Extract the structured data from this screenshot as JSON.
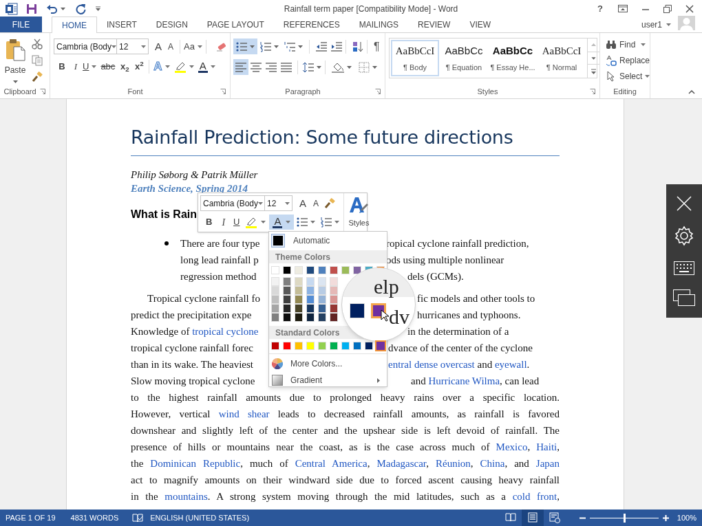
{
  "title_bar": {
    "title": "Rainfall term paper [Compatibility Mode] - Word",
    "help": "?"
  },
  "tabs": [
    {
      "label": "FILE",
      "kind": "file",
      "selected": false
    },
    {
      "label": "HOME",
      "kind": "tab",
      "selected": true
    },
    {
      "label": "INSERT",
      "kind": "tab",
      "selected": false
    },
    {
      "label": "DESIGN",
      "kind": "tab",
      "selected": false
    },
    {
      "label": "PAGE LAYOUT",
      "kind": "tab",
      "selected": false
    },
    {
      "label": "REFERENCES",
      "kind": "tab",
      "selected": false
    },
    {
      "label": "MAILINGS",
      "kind": "tab",
      "selected": false
    },
    {
      "label": "REVIEW",
      "kind": "tab",
      "selected": false
    },
    {
      "label": "VIEW",
      "kind": "tab",
      "selected": false
    }
  ],
  "account": {
    "user": "user1"
  },
  "ribbon": {
    "clipboard": {
      "paste": "Paste",
      "label": "Clipboard"
    },
    "font": {
      "name": "Cambria (Body",
      "size": "12",
      "grow": "A",
      "shrink": "A",
      "change_case": "Aa",
      "bold": "B",
      "italic": "I",
      "underline": "U",
      "strikethrough": "abc",
      "subscript": "x$_{2}$",
      "superscript": "x$^{2}$",
      "text_effects": "A",
      "font_color": "A",
      "label": "Font"
    },
    "paragraph": {
      "list_buttons": [
        {
          "kind": "bullets",
          "selected": true
        },
        {
          "kind": "numbering",
          "selected": false
        },
        {
          "kind": "multilevel",
          "selected": false
        }
      ],
      "show_marks": "¶",
      "align_buttons": [
        {
          "kind": "left",
          "selected": true
        },
        {
          "kind": "center",
          "selected": false
        },
        {
          "kind": "right",
          "selected": false
        },
        {
          "kind": "justify",
          "selected": false
        }
      ],
      "label": "Paragraph"
    },
    "styles": {
      "items": [
        {
          "preview": "AaBbCcI",
          "name": "¶ Body",
          "kind": "serif",
          "selected": true
        },
        {
          "preview": "AaBbCc",
          "name": "¶ Equation",
          "kind": "sans",
          "selected": false
        },
        {
          "preview": "AaBbCc",
          "name": "¶ Essay He...",
          "kind": "bold",
          "selected": false
        },
        {
          "preview": "AaBbCcI",
          "name": "¶ Normal",
          "kind": "serif",
          "selected": false
        }
      ],
      "label": "Styles"
    },
    "editing": {
      "find": "Find",
      "replace": "Replace",
      "select": "Select",
      "label": "Editing"
    }
  },
  "document": {
    "title": "Rainfall Prediction: Some future directions",
    "authors": "Philip Søborg & Patrik Müller",
    "course": "Earth Science, Spring 2014",
    "heading": "What is Rain",
    "bullet_lines": [
      {
        "left": [
          {
            "text": "There are four type",
            "link": false
          }
        ],
        "right": [
          {
            "text": "ropical cyclone rainfall prediction,",
            "link": false
          }
        ]
      },
      {
        "left": [
          {
            "text": "long lead rainfall p",
            "link": false
          }
        ],
        "right": [
          {
            "text": "ods using multiple nonlinear",
            "link": false
          }
        ]
      },
      {
        "left": [
          {
            "text": "regression method",
            "link": false
          }
        ],
        "right": [
          {
            "text": "dels (GCMs).",
            "link": false
          }
        ]
      }
    ],
    "paragraph_lines": [
      {
        "kind": "split",
        "left": [
          {
            "text": "Tropical cyclone rainfall fo",
            "link": false
          }
        ],
        "right": [
          {
            "text": "fic models and other tools to",
            "link": false
          }
        ]
      },
      {
        "kind": "split",
        "left": [
          {
            "text": "predict the precipitation expe",
            "link": false
          }
        ],
        "right": [
          {
            "text": "hurricanes and typhoons.",
            "link": false
          }
        ]
      },
      {
        "kind": "split",
        "left": [
          {
            "text": "Knowledge of ",
            "link": false
          },
          {
            "text": "tropical cyclone",
            "link": true
          }
        ],
        "right": [
          {
            "text": "in the determination of a",
            "link": false
          }
        ]
      },
      {
        "kind": "split",
        "left": [
          {
            "text": "tropical cyclone rainfall forec",
            "link": false
          }
        ],
        "right": [
          {
            "text": "dvance of the center of the cyclone",
            "link": false
          }
        ]
      },
      {
        "kind": "split",
        "left": [
          {
            "text": "than in its wake. The heaviest",
            "link": false
          }
        ],
        "right": [
          {
            "text": "entral dense overcast",
            "link": true
          },
          {
            "text": " and ",
            "link": false
          },
          {
            "text": "eyewall",
            "link": true
          },
          {
            "text": ".",
            "link": false
          }
        ]
      },
      {
        "kind": "split",
        "left": [
          {
            "text": "Slow moving tropical cyclone",
            "link": false
          }
        ],
        "right": [
          {
            "text": "and ",
            "link": false
          },
          {
            "text": "Hurricane Wilma",
            "link": true
          },
          {
            "text": ", can lead",
            "link": false
          }
        ]
      },
      {
        "kind": "full",
        "segments": [
          {
            "text": "to the highest rainfall amounts due to prolonged heavy rains over a specific location.",
            "link": false
          }
        ]
      },
      {
        "kind": "full",
        "segments": [
          {
            "text": "However, vertical ",
            "link": false
          },
          {
            "text": "wind shear",
            "link": true
          },
          {
            "text": " leads to decreased rainfall amounts, as rainfall is favored",
            "link": false
          }
        ]
      },
      {
        "kind": "full",
        "segments": [
          {
            "text": "downshear and slightly left of the center and the upshear side is left devoid of rainfall. The",
            "link": false
          }
        ]
      },
      {
        "kind": "full",
        "segments": [
          {
            "text": "presence of hills or mountains near the coast, as is the case across much of ",
            "link": false
          },
          {
            "text": "Mexico",
            "link": true
          },
          {
            "text": ", ",
            "link": false
          },
          {
            "text": "Haiti",
            "link": true
          },
          {
            "text": ",",
            "link": false
          }
        ]
      },
      {
        "kind": "full",
        "segments": [
          {
            "text": "the ",
            "link": false
          },
          {
            "text": "Dominican Republic",
            "link": true
          },
          {
            "text": ", much of ",
            "link": false
          },
          {
            "text": "Central America",
            "link": true
          },
          {
            "text": ", ",
            "link": false
          },
          {
            "text": "Madagascar",
            "link": true
          },
          {
            "text": ", ",
            "link": false
          },
          {
            "text": "Réunion",
            "link": true
          },
          {
            "text": ", ",
            "link": false
          },
          {
            "text": "China",
            "link": true
          },
          {
            "text": ", and ",
            "link": false
          },
          {
            "text": "Japan",
            "link": true
          }
        ]
      },
      {
        "kind": "full",
        "segments": [
          {
            "text": "act to magnify amounts on their windward side due to forced ascent causing heavy rainfall",
            "link": false
          }
        ]
      },
      {
        "kind": "full",
        "segments": [
          {
            "text": "in the ",
            "link": false
          },
          {
            "text": "mountains",
            "link": true
          },
          {
            "text": ". A strong system moving through the mid latitudes, such as a ",
            "link": false
          },
          {
            "text": "cold front",
            "link": true
          },
          {
            "text": ",",
            "link": false
          }
        ]
      }
    ]
  },
  "mini_toolbar": {
    "font": "Cambria (Body",
    "size": "12",
    "grow": "A",
    "shrink": "A",
    "bold": "B",
    "italic": "I",
    "underline": "U",
    "font_color": "A",
    "font_color_open": true,
    "styles": "Styles"
  },
  "color_menu": {
    "automatic": "Automatic",
    "theme_header": "Theme Colors",
    "theme": [
      {
        "color": "#ffffff",
        "selected": false,
        "shades": [
          {
            "color": "#f2f2f2",
            "selected": false
          },
          {
            "color": "#d9d9d9",
            "selected": false
          },
          {
            "color": "#bfbfbf",
            "selected": false
          },
          {
            "color": "#a6a6a6",
            "selected": false
          },
          {
            "color": "#808080",
            "selected": false
          }
        ]
      },
      {
        "color": "#000000",
        "selected": false,
        "shades": [
          {
            "color": "#7f7f7f",
            "selected": false
          },
          {
            "color": "#595959",
            "selected": false
          },
          {
            "color": "#404040",
            "selected": false
          },
          {
            "color": "#262626",
            "selected": false
          },
          {
            "color": "#0d0d0d",
            "selected": false
          }
        ]
      },
      {
        "color": "#eeece1",
        "selected": false,
        "shades": [
          {
            "color": "#ddd9c3",
            "selected": false
          },
          {
            "color": "#c4bd97",
            "selected": false
          },
          {
            "color": "#938953",
            "selected": false
          },
          {
            "color": "#494429",
            "selected": false
          },
          {
            "color": "#1d1b10",
            "selected": false
          }
        ]
      },
      {
        "color": "#1f497d",
        "selected": false,
        "shades": [
          {
            "color": "#c6d9f0",
            "selected": false
          },
          {
            "color": "#8db3e2",
            "selected": false
          },
          {
            "color": "#548dd4",
            "selected": false
          },
          {
            "color": "#17365d",
            "selected": false
          },
          {
            "color": "#0f243e",
            "selected": false
          }
        ]
      },
      {
        "color": "#4f81bd",
        "selected": false,
        "shades": [
          {
            "color": "#dbe5f1",
            "selected": false
          },
          {
            "color": "#b8cce4",
            "selected": false
          },
          {
            "color": "#95b3d7",
            "selected": false
          },
          {
            "color": "#366092",
            "selected": false
          },
          {
            "color": "#244061",
            "selected": false
          }
        ]
      },
      {
        "color": "#c0504d",
        "selected": false,
        "shades": [
          {
            "color": "#f2dcdb",
            "selected": false
          },
          {
            "color": "#e5b9b7",
            "selected": false
          },
          {
            "color": "#d99694",
            "selected": false
          },
          {
            "color": "#953734",
            "selected": false
          },
          {
            "color": "#632423",
            "selected": false
          }
        ]
      },
      {
        "color": "#9bbb59",
        "selected": false
      },
      {
        "color": "#8064a2",
        "selected": false
      },
      {
        "color": "#4bacc6",
        "selected": false
      },
      {
        "color": "#f79646",
        "selected": false
      }
    ],
    "standard_header": "Standard Colors",
    "standard": [
      {
        "color": "#c00000",
        "selected": false
      },
      {
        "color": "#ff0000",
        "selected": false
      },
      {
        "color": "#ffc000",
        "selected": false
      },
      {
        "color": "#ffff00",
        "selected": false
      },
      {
        "color": "#92d050",
        "selected": false
      },
      {
        "color": "#00b050",
        "selected": false
      },
      {
        "color": "#00b0f0",
        "selected": false
      },
      {
        "color": "#0070c0",
        "selected": false
      },
      {
        "color": "#002060",
        "selected": false
      },
      {
        "color": "#7030a0",
        "selected": true
      }
    ],
    "more": "More Colors...",
    "gradient": "Gradient"
  },
  "magnifier": {
    "text_top": "elp",
    "text_bottom": "dv"
  },
  "status_bar": {
    "page": "PAGE 1 OF 19",
    "words": "4831 WORDS",
    "language": "ENGLISH (UNITED STATES)",
    "views": [
      {
        "kind": "read",
        "selected": false
      },
      {
        "kind": "print",
        "selected": true
      },
      {
        "kind": "web",
        "selected": false
      }
    ],
    "zoom": {
      "level": 0.5,
      "reading": "100%"
    }
  }
}
